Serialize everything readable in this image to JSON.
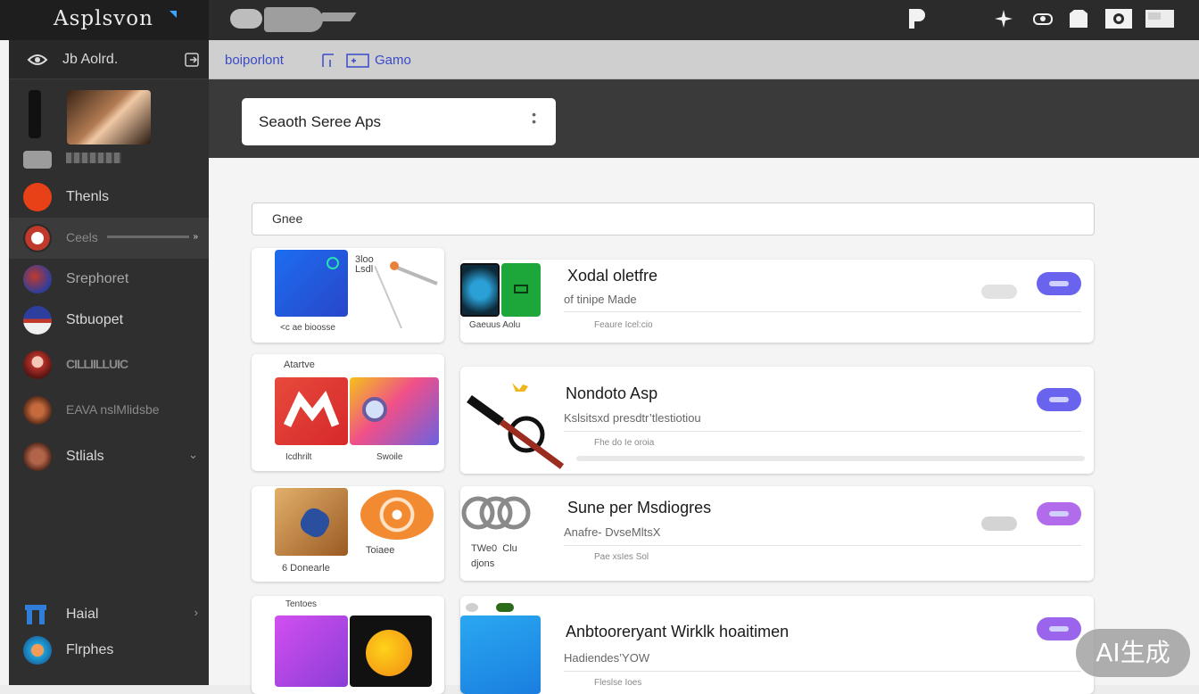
{
  "app": {
    "title": "Asplsvon"
  },
  "sidebar": {
    "header_label": "Jb Aolrd.",
    "items": [
      {
        "label": "Thenls",
        "icon": "flame-icon"
      },
      {
        "label": "Ceels",
        "icon": "compass-icon"
      },
      {
        "label": "Srephoret",
        "icon": "globe-icon"
      },
      {
        "label": "Stbuopet",
        "icon": "flag-globe-icon"
      },
      {
        "label": "CILLIILLUIC",
        "icon": "portrait-icon"
      },
      {
        "label": "EAVA nslMlidsbe",
        "icon": "mask-icon"
      },
      {
        "label": "Stlials",
        "icon": "face-icon"
      },
      {
        "label": "Haial",
        "icon": "home-icon"
      },
      {
        "label": "Flrphes",
        "icon": "bowl-icon"
      }
    ]
  },
  "subheader": {
    "link1": "boiporlont",
    "link2": "Gamo"
  },
  "search": {
    "placeholder": "Seaoth  Seree Aps"
  },
  "category_filter": {
    "label": "Gnee"
  },
  "left_cards": [
    {
      "tile1_caption": "<c  ae  bioosse",
      "side_text": "3loo\nLsdl"
    },
    {
      "header": "Atartve",
      "tile1_caption": "Icdhrilt",
      "tile2_caption": "Swoile"
    },
    {
      "tile1_caption": "6 Donearle",
      "tile2_caption": "Toiaee"
    },
    {
      "header": "Tentoes"
    }
  ],
  "apps": [
    {
      "title": "Xodal oletfre",
      "subtitle": "of tinipe Made",
      "meta": "Feaure Icel:cio",
      "thumb_caption": "Gaeuus Aolu"
    },
    {
      "title": "Nondoto Asp",
      "subtitle": "Kslsitsxd presdtr’tlestiotiou",
      "meta": "Fhe do  Ie oroia"
    },
    {
      "title": "Sune per Msdiogres",
      "subtitle": "Anafre- DvseMltsX",
      "meta": "Pae  xsIes Sol",
      "thumb_caption": "TWe0  Clu\ndjons"
    },
    {
      "title": "Anbtooreryant Wirklk hoaitimen",
      "subtitle": "Hadiendes’YOW",
      "meta": "Fleslse Ioes"
    }
  ],
  "watermark": "AI生成",
  "colors": {
    "accent": "#6a63ee",
    "sidebar_bg": "#2f2f2f",
    "topbar_bg": "#2b2b2b",
    "link": "#3a49c9"
  }
}
